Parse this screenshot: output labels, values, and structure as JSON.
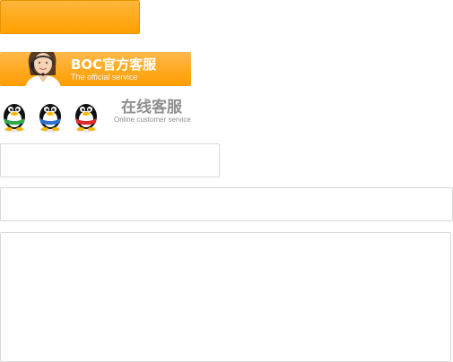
{
  "top_button": {
    "label": ""
  },
  "official_banner": {
    "title": "BOC官方客服",
    "subtitle": "The official service",
    "icon": "customer-service-agent-icon"
  },
  "online_service": {
    "icons": [
      "qq-penguin-green-icon",
      "qq-penguin-blue-icon",
      "qq-penguin-red-icon"
    ],
    "title": "在线客服",
    "subtitle": "Online customer service"
  },
  "form": {
    "field1": {
      "value": "",
      "placeholder": ""
    },
    "field2": {
      "value": "",
      "placeholder": ""
    },
    "message": {
      "value": "",
      "placeholder": ""
    }
  },
  "colors": {
    "accent_orange": "#ffa000",
    "online_text_gray": "#8f8f8f",
    "border_gray": "#d9d9d9"
  }
}
